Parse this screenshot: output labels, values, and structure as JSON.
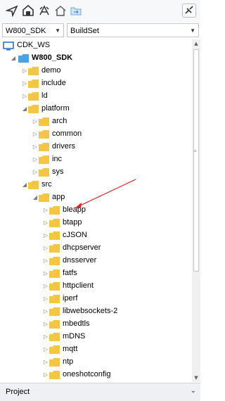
{
  "toolbar": {
    "icons": [
      "navigate-arrow-icon",
      "home-outline-icon",
      "workspace-icon",
      "home-icon",
      "folder-sync-icon"
    ],
    "right_icon": "link-editor-icon"
  },
  "combos": {
    "project_value": "W800_SDK",
    "config_value": "BuildSet"
  },
  "tree": {
    "workspace": "CDK_WS",
    "project": "W800_SDK",
    "items": [
      {
        "label": "demo"
      },
      {
        "label": "include"
      },
      {
        "label": "ld"
      },
      {
        "label": "platform"
      },
      {
        "label": "arch"
      },
      {
        "label": "common"
      },
      {
        "label": "drivers"
      },
      {
        "label": "inc"
      },
      {
        "label": "sys"
      },
      {
        "label": "src"
      },
      {
        "label": "app"
      },
      {
        "label": "bleapp"
      },
      {
        "label": "btapp"
      },
      {
        "label": "cJSON"
      },
      {
        "label": "dhcpserver"
      },
      {
        "label": "dnsserver"
      },
      {
        "label": "fatfs"
      },
      {
        "label": "httpclient"
      },
      {
        "label": "iperf"
      },
      {
        "label": "libwebsockets-2"
      },
      {
        "label": "mbedtls"
      },
      {
        "label": "mDNS"
      },
      {
        "label": "mqtt"
      },
      {
        "label": "ntp"
      },
      {
        "label": "oneshotconfig"
      }
    ]
  },
  "bottom": {
    "tab_label": "Project"
  },
  "colors": {
    "folder": "#f3c743",
    "project_folder": "#4aa3df",
    "annotation": "#e02020"
  }
}
